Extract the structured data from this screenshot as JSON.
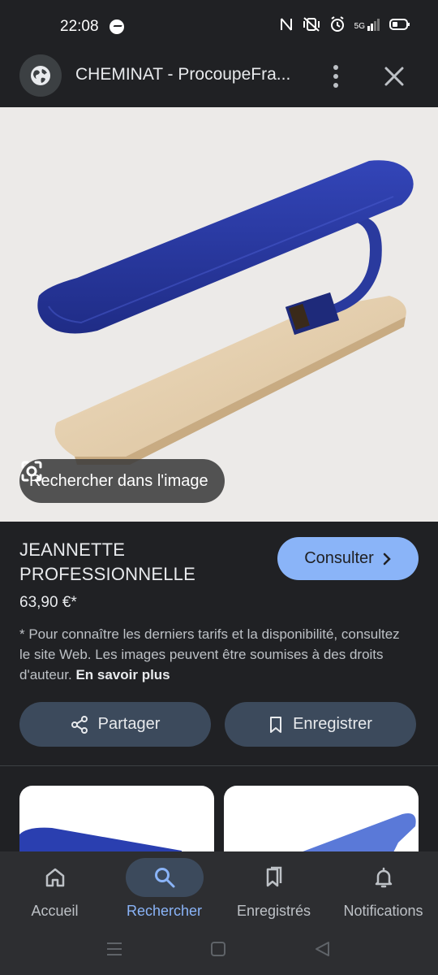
{
  "status_bar": {
    "time": "22:08",
    "network": "5G"
  },
  "header": {
    "title": "CHEMINAT - ProcoupeFra..."
  },
  "image": {
    "lens_label": "Rechercher dans l'image"
  },
  "product": {
    "title_line1": "JEANNETTE",
    "title_line2": "PROFESSIONNELLE",
    "price": "63,90 €*",
    "consult_label": "Consulter",
    "disclaimer": "* Pour connaître les derniers tarifs et la disponibilité, consultez le site Web. Les images peuvent être soumises à des droits d'auteur.",
    "learn_more": "En savoir plus"
  },
  "actions": {
    "share_label": "Partager",
    "save_label": "Enregistrer"
  },
  "bottom_nav": {
    "items": [
      {
        "label": "Accueil",
        "icon": "home-icon"
      },
      {
        "label": "Rechercher",
        "icon": "search-icon",
        "active": true
      },
      {
        "label": "Enregistrés",
        "icon": "bookmarks-icon"
      },
      {
        "label": "Notifications",
        "icon": "bell-icon"
      }
    ]
  },
  "colors": {
    "accent": "#8ab4f8",
    "background": "#202124",
    "pill": "#3c4a5c",
    "board_blue": "#2a3a9e"
  }
}
